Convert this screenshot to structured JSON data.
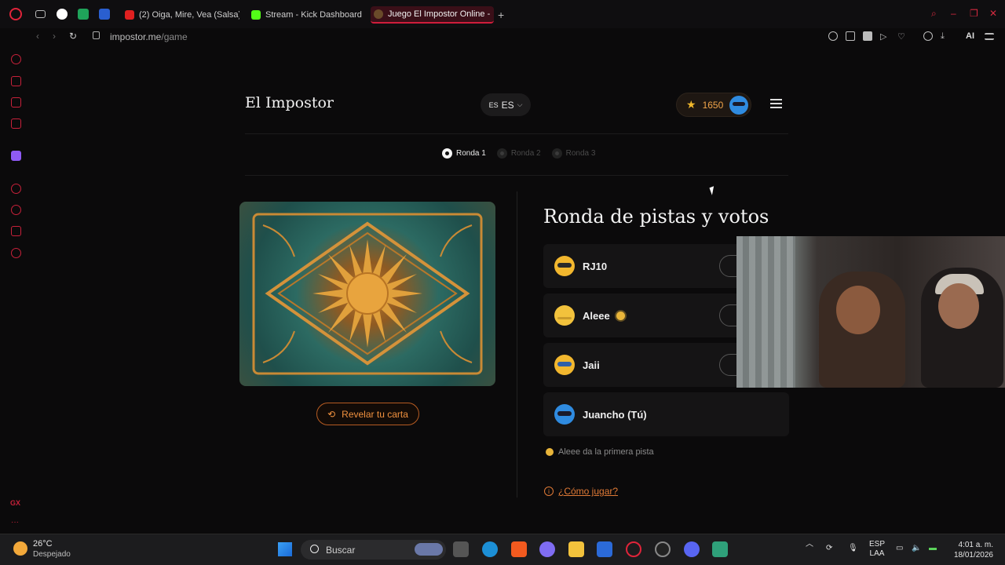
{
  "browser": {
    "tabs": [
      {
        "label": "(2) Oiga, Mire, Vea (Salsa)",
        "fav_color": "#e02020"
      },
      {
        "label": "Stream - Kick Dashboard",
        "fav_color": "#53fc18"
      },
      {
        "label": "Juego El Impostor Online -",
        "fav_color": "#6a4a2a",
        "active": true
      }
    ],
    "url_host": "impostor.me",
    "url_path": "/game",
    "ai_label": "AI"
  },
  "header": {
    "title": "El Impostor",
    "lang_small": "ES",
    "lang": "ES",
    "score": "1650"
  },
  "rounds": [
    {
      "label": "Ronda 1",
      "active": true
    },
    {
      "label": "Ronda 2",
      "active": false
    },
    {
      "label": "Ronda 3",
      "active": false
    }
  ],
  "card": {
    "reveal_label": "Revelar tu carta"
  },
  "main": {
    "title": "Ronda de pistas y votos",
    "players": [
      {
        "name": "RJ10",
        "avatar_color": "#f2b72e",
        "band_color": "#2a2a2a"
      },
      {
        "name": "Aleee",
        "avatar_color": "#f2c23c",
        "band_color": "#c99a2a",
        "first": true
      },
      {
        "name": "Jaii",
        "avatar_color": "#f2b72e",
        "band_color": "#2f5fa8"
      },
      {
        "name": "Juancho (Tú)",
        "avatar_color": "#2f8be0",
        "band_color": "#1a1a2a"
      }
    ],
    "hint": "Aleee da la primera pista",
    "how_to": "¿Cómo jugar?"
  },
  "taskbar": {
    "temp": "26°C",
    "condition": "Despejado",
    "search": "Buscar",
    "lang1": "ESP",
    "lang2": "LAA",
    "time": "4:01 a. m.",
    "date": "18/01/2026"
  },
  "colors": {
    "accent_orange": "#f0913f",
    "opera_red": "#d01d3b",
    "score_text": "#f0a44a"
  }
}
